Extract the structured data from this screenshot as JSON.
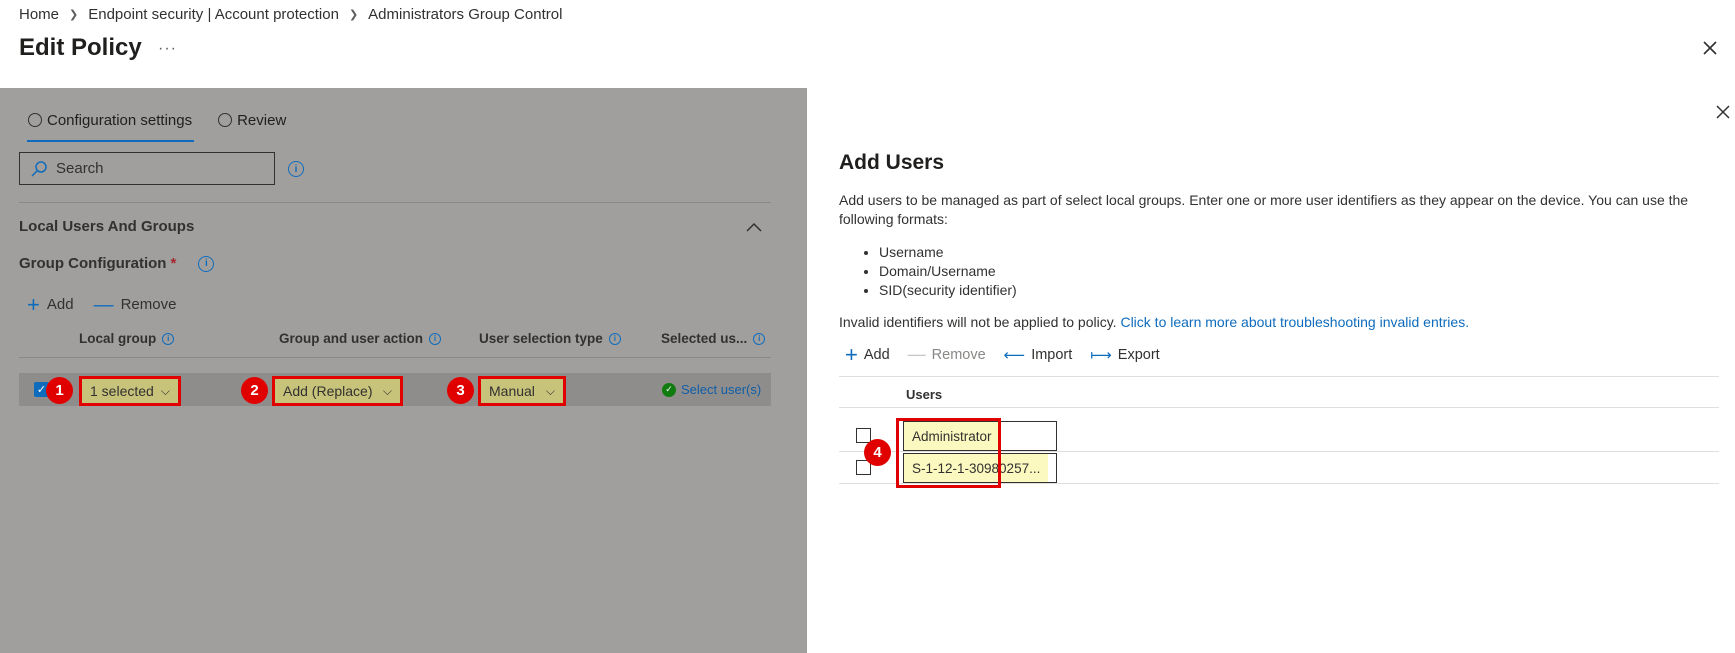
{
  "breadcrumb": [
    "Home",
    "Endpoint security | Account protection",
    "Administrators Group Control"
  ],
  "header": {
    "title": "Edit Policy",
    "more": "···"
  },
  "tabs": [
    {
      "label": "Configuration settings"
    },
    {
      "label": "Review"
    }
  ],
  "search": {
    "placeholder": "Search"
  },
  "section": {
    "title": "Local Users And Groups"
  },
  "group_config": {
    "label": "Group Configuration",
    "required": "*"
  },
  "commands": {
    "add": "Add",
    "remove": "Remove"
  },
  "table": {
    "headers": [
      "Local group",
      "Group and user action",
      "User selection type",
      "Selected us..."
    ],
    "row": {
      "local_group": "1 selected",
      "action": "Add (Replace)",
      "selection_type": "Manual",
      "selected_users": "Select user(s)"
    }
  },
  "badges": [
    "1",
    "2",
    "3",
    "4"
  ],
  "panel": {
    "title": "Add Users",
    "description": "Add users to be managed as part of select local groups. Enter one or more user identifiers as they appear on the device. You can use the following formats:",
    "formats": [
      "Username",
      "Domain/Username",
      "SID(security identifier)"
    ],
    "invalid_text": "Invalid identifiers will not be applied to policy.",
    "invalid_link": "Click to learn more about troubleshooting invalid entries.",
    "commands": {
      "add": "Add",
      "remove": "Remove",
      "import": "Import",
      "export": "Export"
    },
    "users_header": "Users",
    "users": [
      "Administrator",
      "S-1-12-1-30980257..."
    ]
  },
  "colors": {
    "accent": "#0f6cbd",
    "highlight": "#e00000",
    "overlay": "#a19f9d"
  }
}
